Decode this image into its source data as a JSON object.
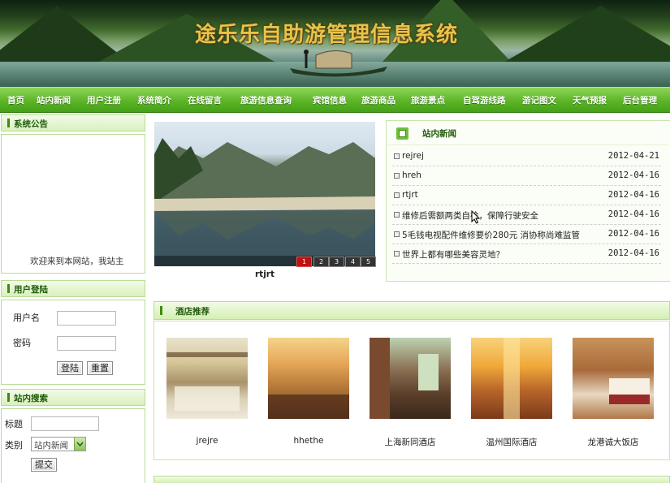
{
  "banner": {
    "title": "途乐乐自助游管理信息系统"
  },
  "nav": {
    "items": [
      "首页",
      "站内新闻",
      "用户注册",
      "系统简介",
      "在线留言",
      "旅游信息查询",
      "宾馆信息",
      "旅游商品",
      "旅游景点",
      "自驾游线路",
      "游记图文",
      "天气预报",
      "后台管理"
    ]
  },
  "announcement": {
    "title": "系统公告",
    "scroll_text": "欢迎来到本网站，我站主"
  },
  "login": {
    "title": "用户登陆",
    "username_label": "用户名",
    "username_value": "",
    "password_label": "密码",
    "password_value": "",
    "login_button": "登陆",
    "reset_button": "重置"
  },
  "search": {
    "title": "站内搜索",
    "title_label": "标题",
    "title_value": "",
    "category_label": "类别",
    "category_selected": "站内新闻",
    "submit_button": "提交"
  },
  "slider": {
    "caption": "rtjrt",
    "pages": [
      "1",
      "2",
      "3",
      "4",
      "5"
    ],
    "active_page": 1
  },
  "news": {
    "title": "站内新闻",
    "items": [
      {
        "title": "rejrej",
        "date": "2012-04-21"
      },
      {
        "title": "hreh",
        "date": "2012-04-16"
      },
      {
        "title": "rtjrt",
        "date": "2012-04-16"
      },
      {
        "title": "维修后需额两类自检，保障行驶安全",
        "date": "2012-04-16"
      },
      {
        "title": "5毛钱电视配件维修要价280元 消协称尚难监管",
        "date": "2012-04-16"
      },
      {
        "title": "世界上都有哪些美容灵地？",
        "date": "2012-04-16"
      }
    ]
  },
  "hotels": {
    "title": "酒店推荐",
    "items": [
      {
        "name": "jrejre"
      },
      {
        "name": "hhethe"
      },
      {
        "name": "上海新同酒店"
      },
      {
        "name": "温州国际酒店"
      },
      {
        "name": "龙港诚大饭店"
      }
    ]
  },
  "colors": {
    "nav_green": "#5cb526",
    "header_green": "#d9f0bf",
    "title_gold": "#e7c34a",
    "thumb_active": "#c01010"
  }
}
